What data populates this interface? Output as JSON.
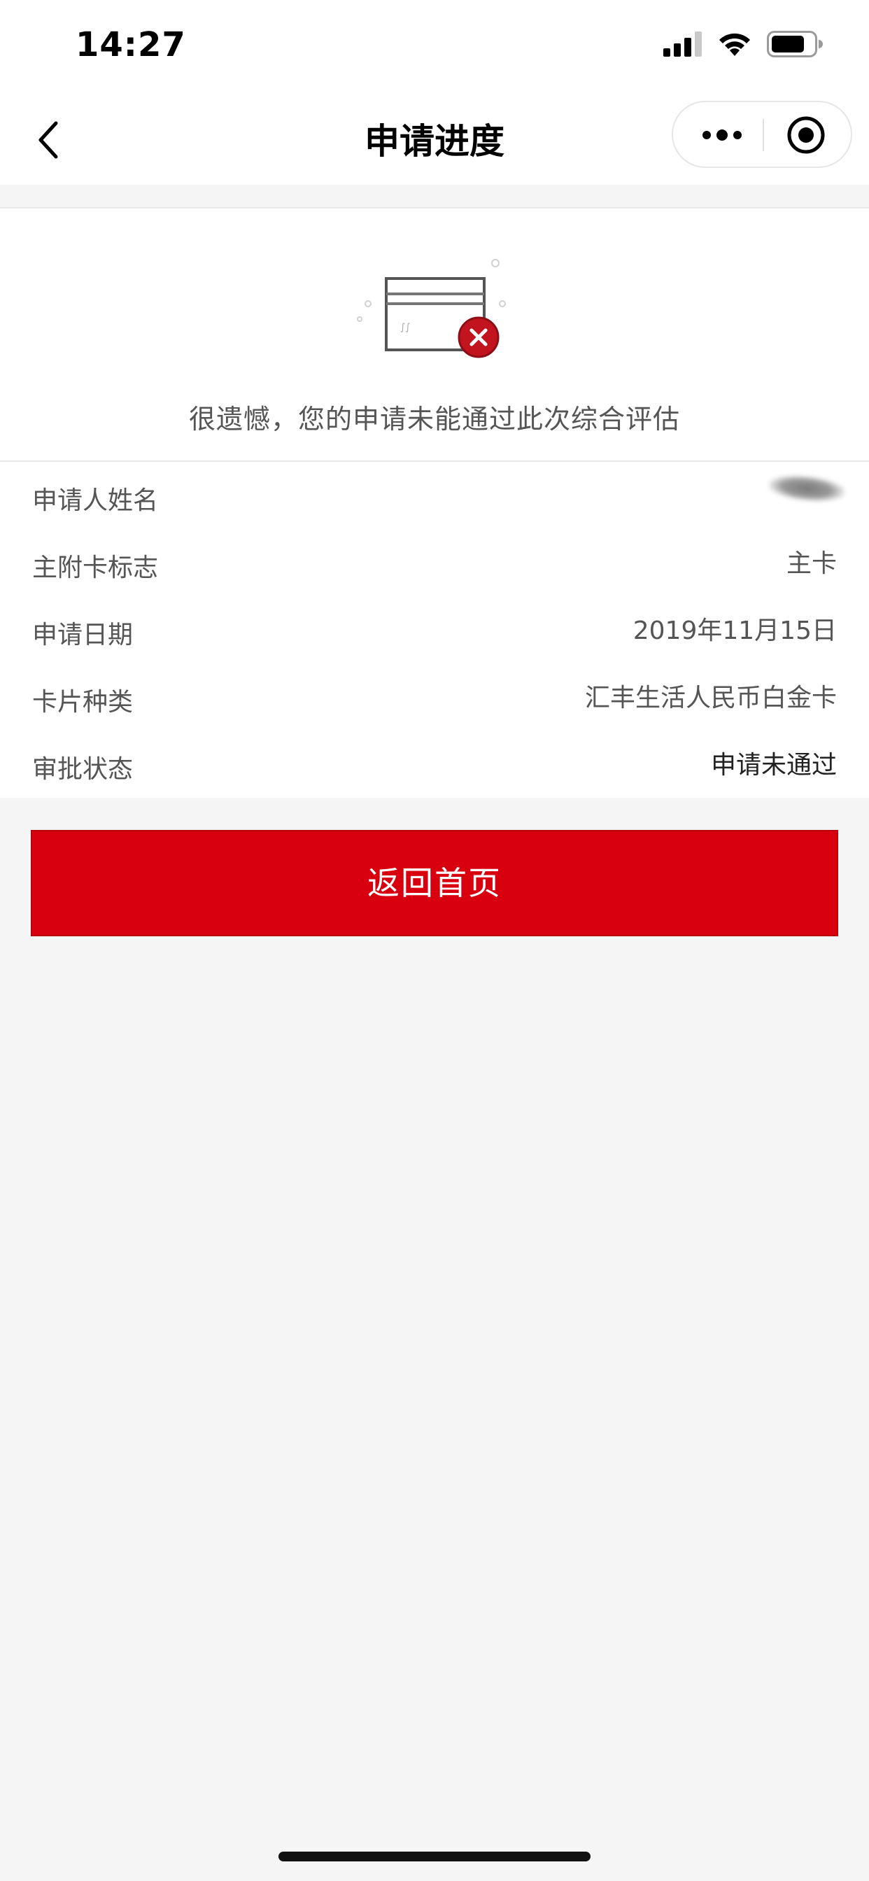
{
  "status_bar": {
    "time": "14:27"
  },
  "nav": {
    "title": "申请进度",
    "back_icon": "chevron-left-icon",
    "more_icon": "more-dots-icon",
    "close_icon": "target-circle-icon"
  },
  "result": {
    "icon": "card-rejected-icon",
    "message": "很遗憾，您的申请未能通过此次综合评估"
  },
  "info": {
    "rows": [
      {
        "label": "申请人姓名",
        "value": ""
      },
      {
        "label": "主附卡标志",
        "value": "主卡"
      },
      {
        "label": "申请日期",
        "value": "2019年11月15日"
      },
      {
        "label": "卡片种类",
        "value": "汇丰生活人民币白金卡"
      },
      {
        "label": "审批状态",
        "value": "申请未通过"
      }
    ]
  },
  "button": {
    "label": "返回首页"
  },
  "colors": {
    "accent": "#d8000f",
    "background": "#f5f5f5",
    "card": "#ffffff"
  }
}
